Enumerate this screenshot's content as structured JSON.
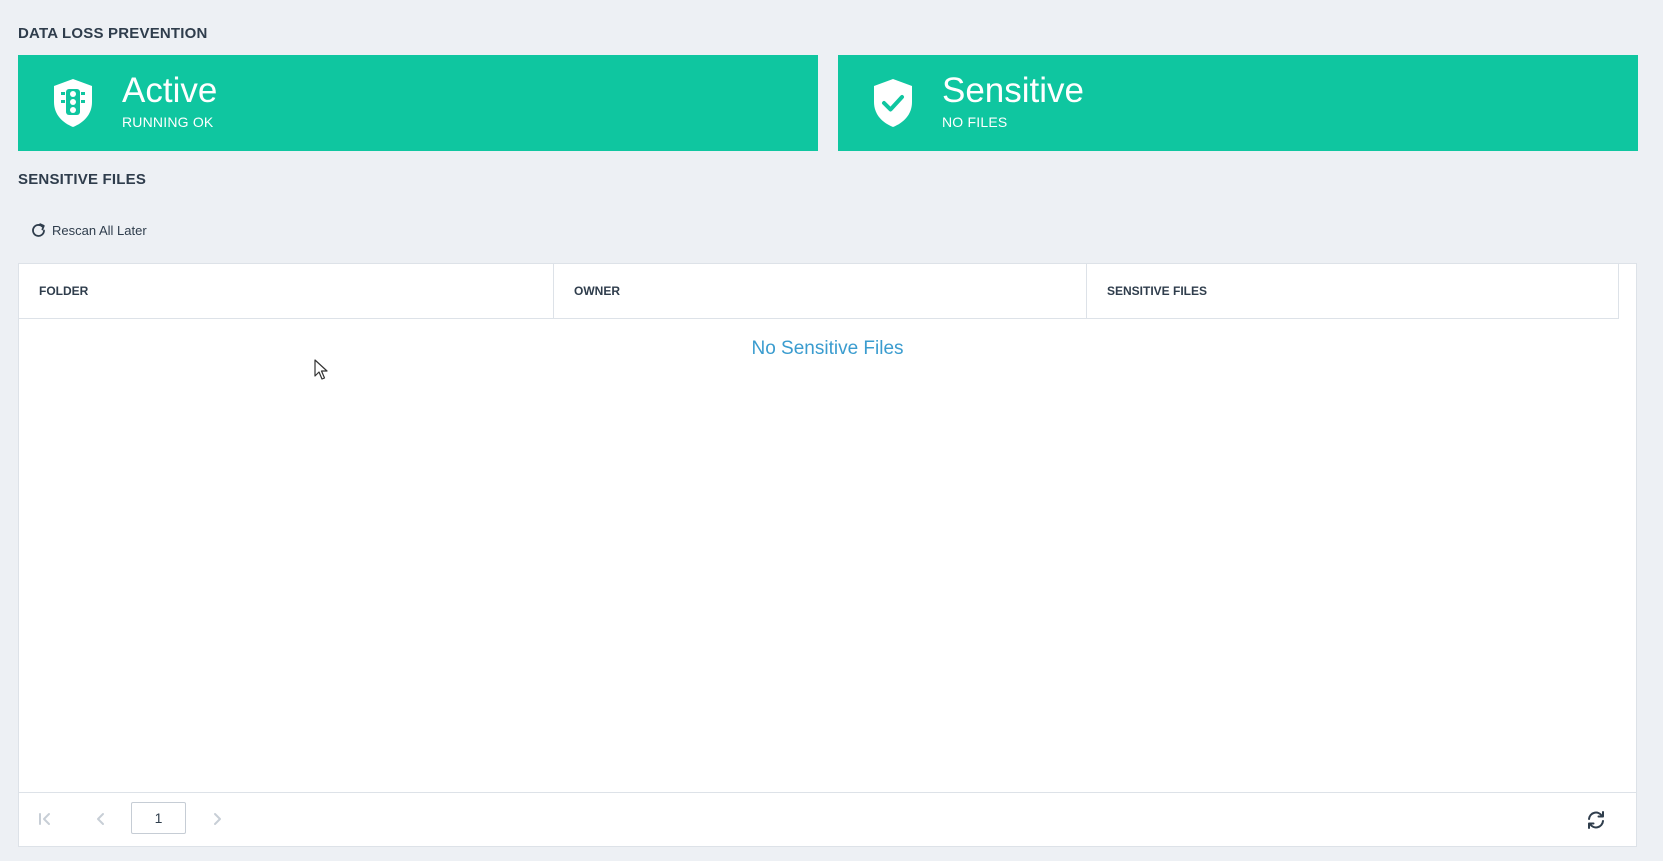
{
  "header": {
    "title": "DATA LOSS PREVENTION"
  },
  "cards": {
    "active": {
      "main": "Active",
      "sub": "RUNNING OK",
      "icon": "traffic-light-shield-icon"
    },
    "sensitive": {
      "main": "Sensitive",
      "sub": "NO FILES",
      "icon": "shield-check-icon"
    }
  },
  "files_section": {
    "title": "SENSITIVE FILES",
    "rescan_label": "Rescan All Later"
  },
  "table": {
    "columns": [
      "FOLDER",
      "OWNER",
      "SENSITIVE FILES"
    ],
    "empty_message": "No Sensitive Files"
  },
  "pager": {
    "page": "1"
  },
  "colors": {
    "accent": "#0fc6a0",
    "link": "#3a9ccf",
    "background": "#edf0f4"
  }
}
